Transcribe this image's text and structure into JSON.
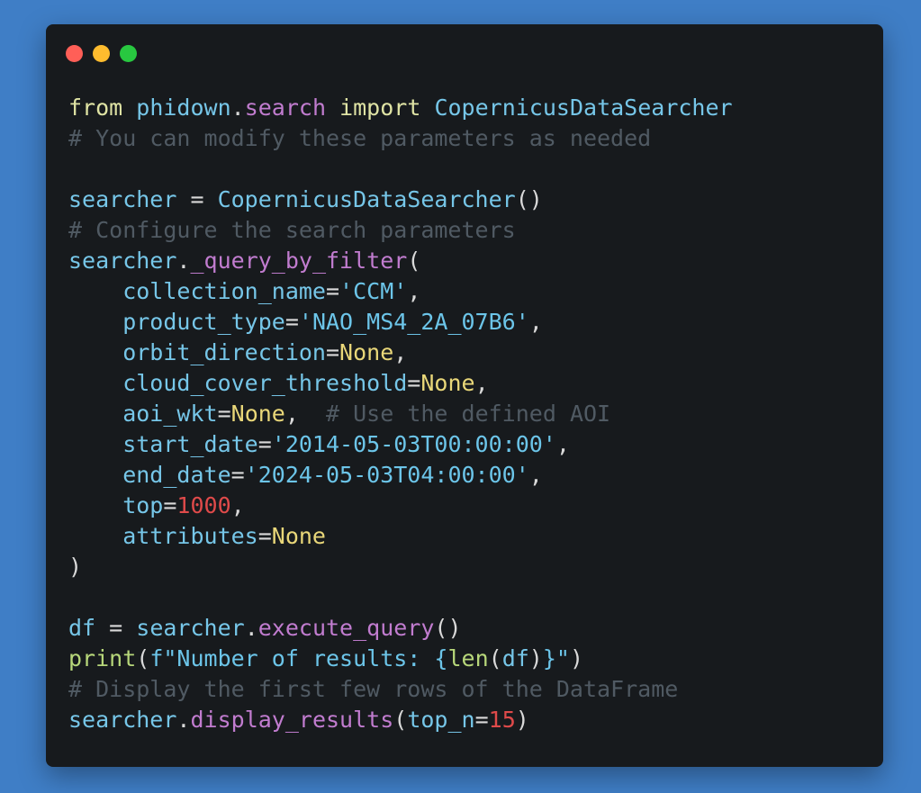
{
  "window": {
    "controls": [
      {
        "name": "close-button",
        "color": "#ff5f57"
      },
      {
        "name": "minimize-button",
        "color": "#febc2e"
      },
      {
        "name": "zoom-button",
        "color": "#28c840"
      }
    ]
  },
  "colors": {
    "keyword": "#dfe3a4",
    "identifier": "#76c6e8",
    "function": "#c17ccf",
    "string": "#6cc5e9",
    "constant": "#e9d779",
    "number": "#df4a4a",
    "comment": "#505a63",
    "punctuation": "#d9d9d9",
    "builtin": "#b7d77a"
  },
  "code": {
    "lines": [
      [
        {
          "t": "from",
          "c": "keyword"
        },
        {
          "t": " ",
          "c": "punctuation"
        },
        {
          "t": "phidown",
          "c": "identifier"
        },
        {
          "t": ".",
          "c": "punctuation"
        },
        {
          "t": "search",
          "c": "function"
        },
        {
          "t": " ",
          "c": "punctuation"
        },
        {
          "t": "import",
          "c": "keyword"
        },
        {
          "t": " ",
          "c": "punctuation"
        },
        {
          "t": "CopernicusDataSearcher",
          "c": "identifier"
        }
      ],
      [
        {
          "t": "# You can modify these parameters as needed",
          "c": "comment"
        }
      ],
      [],
      [
        {
          "t": "searcher",
          "c": "identifier"
        },
        {
          "t": " = ",
          "c": "punctuation"
        },
        {
          "t": "CopernicusDataSearcher",
          "c": "identifier"
        },
        {
          "t": "()",
          "c": "punctuation"
        }
      ],
      [
        {
          "t": "# Configure the search parameters",
          "c": "comment"
        }
      ],
      [
        {
          "t": "searcher",
          "c": "identifier"
        },
        {
          "t": ".",
          "c": "punctuation"
        },
        {
          "t": "_query_by_filter",
          "c": "function"
        },
        {
          "t": "(",
          "c": "punctuation"
        }
      ],
      [
        {
          "t": "    collection_name",
          "c": "identifier"
        },
        {
          "t": "=",
          "c": "punctuation"
        },
        {
          "t": "'CCM'",
          "c": "string"
        },
        {
          "t": ",",
          "c": "punctuation"
        }
      ],
      [
        {
          "t": "    product_type",
          "c": "identifier"
        },
        {
          "t": "=",
          "c": "punctuation"
        },
        {
          "t": "'NAO_MS4_2A_07B6'",
          "c": "string"
        },
        {
          "t": ",",
          "c": "punctuation"
        }
      ],
      [
        {
          "t": "    orbit_direction",
          "c": "identifier"
        },
        {
          "t": "=",
          "c": "punctuation"
        },
        {
          "t": "None",
          "c": "constant"
        },
        {
          "t": ",",
          "c": "punctuation"
        }
      ],
      [
        {
          "t": "    cloud_cover_threshold",
          "c": "identifier"
        },
        {
          "t": "=",
          "c": "punctuation"
        },
        {
          "t": "None",
          "c": "constant"
        },
        {
          "t": ",",
          "c": "punctuation"
        }
      ],
      [
        {
          "t": "    aoi_wkt",
          "c": "identifier"
        },
        {
          "t": "=",
          "c": "punctuation"
        },
        {
          "t": "None",
          "c": "constant"
        },
        {
          "t": ",  ",
          "c": "punctuation"
        },
        {
          "t": "# Use the defined AOI",
          "c": "comment"
        }
      ],
      [
        {
          "t": "    start_date",
          "c": "identifier"
        },
        {
          "t": "=",
          "c": "punctuation"
        },
        {
          "t": "'2014-05-03T00:00:00'",
          "c": "string"
        },
        {
          "t": ",",
          "c": "punctuation"
        }
      ],
      [
        {
          "t": "    end_date",
          "c": "identifier"
        },
        {
          "t": "=",
          "c": "punctuation"
        },
        {
          "t": "'2024-05-03T04:00:00'",
          "c": "string"
        },
        {
          "t": ",",
          "c": "punctuation"
        }
      ],
      [
        {
          "t": "    top",
          "c": "identifier"
        },
        {
          "t": "=",
          "c": "punctuation"
        },
        {
          "t": "1000",
          "c": "number"
        },
        {
          "t": ",",
          "c": "punctuation"
        }
      ],
      [
        {
          "t": "    attributes",
          "c": "identifier"
        },
        {
          "t": "=",
          "c": "punctuation"
        },
        {
          "t": "None",
          "c": "constant"
        }
      ],
      [
        {
          "t": ")",
          "c": "punctuation"
        }
      ],
      [],
      [
        {
          "t": "df",
          "c": "identifier"
        },
        {
          "t": " = ",
          "c": "punctuation"
        },
        {
          "t": "searcher",
          "c": "identifier"
        },
        {
          "t": ".",
          "c": "punctuation"
        },
        {
          "t": "execute_query",
          "c": "function"
        },
        {
          "t": "()",
          "c": "punctuation"
        }
      ],
      [
        {
          "t": "print",
          "c": "builtin"
        },
        {
          "t": "(",
          "c": "punctuation"
        },
        {
          "t": "f\"Number of results: {",
          "c": "string"
        },
        {
          "t": "len",
          "c": "builtin"
        },
        {
          "t": "(",
          "c": "punctuation"
        },
        {
          "t": "df",
          "c": "identifier"
        },
        {
          "t": ")",
          "c": "punctuation"
        },
        {
          "t": "}\"",
          "c": "string"
        },
        {
          "t": ")",
          "c": "punctuation"
        }
      ],
      [
        {
          "t": "# Display the first few rows of the DataFrame",
          "c": "comment"
        }
      ],
      [
        {
          "t": "searcher",
          "c": "identifier"
        },
        {
          "t": ".",
          "c": "punctuation"
        },
        {
          "t": "display_results",
          "c": "function"
        },
        {
          "t": "(",
          "c": "punctuation"
        },
        {
          "t": "top_n",
          "c": "identifier"
        },
        {
          "t": "=",
          "c": "punctuation"
        },
        {
          "t": "15",
          "c": "number"
        },
        {
          "t": ")",
          "c": "punctuation"
        }
      ]
    ]
  }
}
